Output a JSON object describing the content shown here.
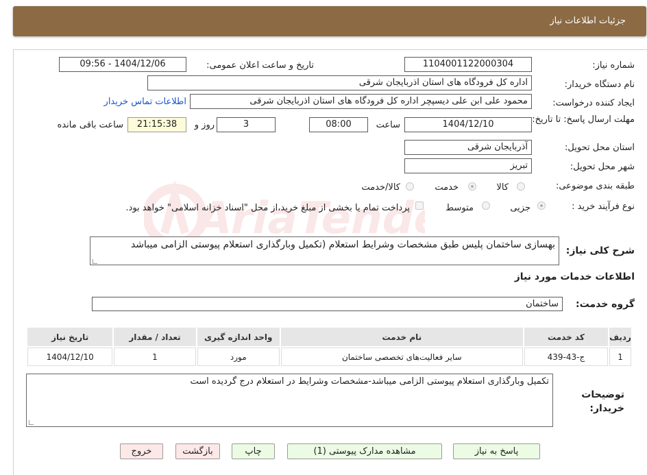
{
  "header": {
    "title": "جزئیات اطلاعات نیاز"
  },
  "need_number": {
    "label": "شماره نیاز:",
    "value": "1104001122000304"
  },
  "announce_datetime": {
    "label": "تاریخ و ساعت اعلان عمومی:",
    "value": "1404/12/06 - 09:56"
  },
  "buyer_org": {
    "label": "نام دستگاه خریدار:",
    "value": "اداره کل فرودگاه های استان اذربایجان شرقی"
  },
  "requester": {
    "label": "ایجاد کننده درخواست:",
    "value": "محمود علی ابن علی دیسپچر اداره کل فرودگاه های استان اذربایجان شرقی",
    "contact_link": "اطلاعات تماس خریدار"
  },
  "deadline": {
    "label": "مهلت ارسال پاسخ: تا تاریخ:",
    "date": "1404/12/10",
    "time_label": "ساعت",
    "time": "08:00",
    "days": "3",
    "days_label": "روز و",
    "remaining": "21:15:38",
    "remaining_label": "ساعت باقی مانده"
  },
  "delivery_province": {
    "label": "استان محل تحویل:",
    "value": "آذربایجان شرقی"
  },
  "delivery_city": {
    "label": "شهر محل تحویل:",
    "value": "تبریز"
  },
  "category": {
    "label": "طبقه بندی موضوعی:",
    "options": [
      "کالا",
      "خدمت",
      "کالا/خدمت"
    ],
    "selected": "خدمت"
  },
  "purchase_process": {
    "label": "نوع فرآیند خرید :",
    "options": [
      "جزیی",
      "متوسط"
    ],
    "selected": "جزیی",
    "payment_note": "پرداخت تمام یا بخشی از مبلغ خرید،از محل \"اسناد خزانه اسلامی\" خواهد بود."
  },
  "summary": {
    "label": "شرح کلی نیاز:",
    "value": "بهسازی ساختمان پلیس طبق مشخصات وشرایط استعلام (تکمیل وبارگذاری استعلام پیوستی الزامی میباشد"
  },
  "services_section": {
    "title": "اطلاعات خدمات مورد نیاز"
  },
  "service_group": {
    "label": "گروه خدمت:",
    "value": "ساختمان"
  },
  "table": {
    "headers": [
      "ردیف",
      "کد خدمت",
      "نام خدمت",
      "واحد اندازه گیری",
      "تعداد / مقدار",
      "تاریخ نیاز"
    ],
    "rows": [
      [
        "1",
        "ج-43-439",
        "سایر فعالیت‌های تخصصی ساختمان",
        "مورد",
        "1",
        "1404/12/10"
      ]
    ]
  },
  "buyer_notes": {
    "label": "توضیحات خریدار:",
    "value": "تکمیل وبارگذاری استعلام پیوستی الزامی میباشد-مشخصات وشرایط در استعلام درج گردیده است"
  },
  "buttons": {
    "reply": "پاسخ به نیاز",
    "attachments": "مشاهده مدارک پیوستی (1)",
    "print": "چاپ",
    "back": "بازگشت",
    "exit": "خروج"
  },
  "watermark": "AriaTender.neT",
  "colors": {
    "header_bg": "#8b6a44",
    "link": "#1a55c9",
    "button_green": "#ecfbe4",
    "button_red": "#fde8e8",
    "remaining_bg": "#fdfbd9"
  }
}
